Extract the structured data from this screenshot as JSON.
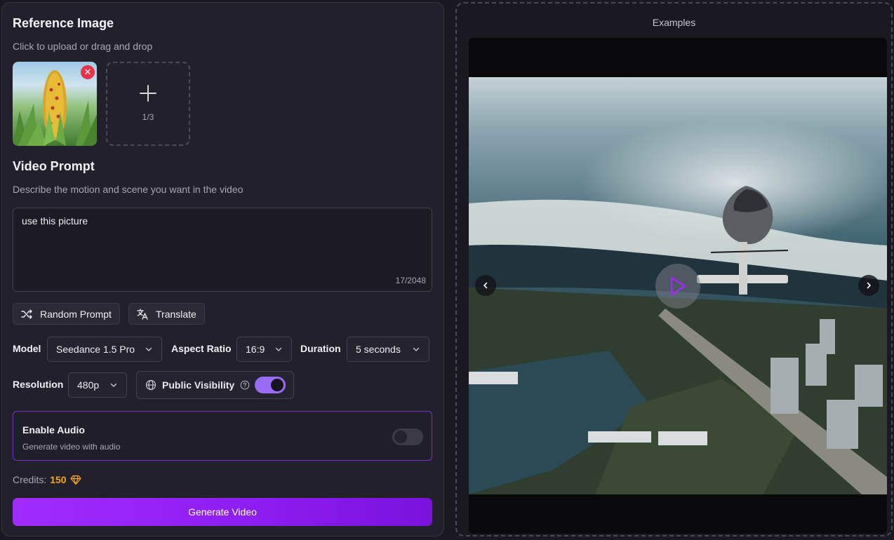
{
  "reference": {
    "title": "Reference Image",
    "subtitle": "Click to upload or drag and drop",
    "remove_glyph": "✕",
    "slot_count": "1/3"
  },
  "prompt": {
    "title": "Video Prompt",
    "subtitle": "Describe the motion and scene you want in the video",
    "value": "use this picture",
    "char_count": "17/2048"
  },
  "actions": {
    "random_label": "Random Prompt",
    "translate_label": "Translate"
  },
  "settings": {
    "model_label": "Model",
    "model_value": "Seedance 1.5 Pro",
    "aspect_label": "Aspect Ratio",
    "aspect_value": "16:9",
    "duration_label": "Duration",
    "duration_value": "5 seconds",
    "resolution_label": "Resolution",
    "resolution_value": "480p",
    "visibility_label": "Public Visibility",
    "visibility_on": true
  },
  "audio": {
    "title": "Enable Audio",
    "subtitle": "Generate video with audio",
    "enabled": false
  },
  "credits": {
    "label": "Credits:",
    "value": "150"
  },
  "generate": {
    "label": "Generate Video"
  },
  "examples": {
    "label": "Examples"
  },
  "colors": {
    "accent": "#9a6cf5",
    "primary_button": "#8c1cf0",
    "credits": "#f5a524",
    "danger": "#e8334a"
  }
}
